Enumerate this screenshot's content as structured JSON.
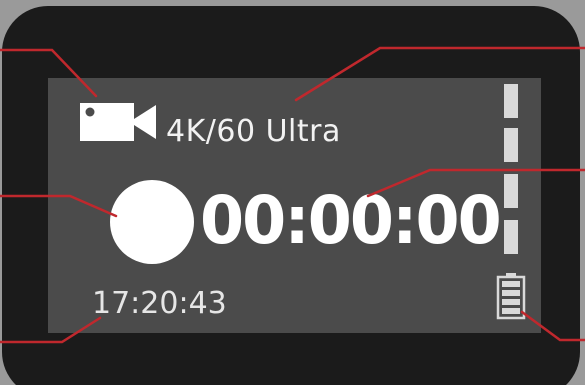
{
  "screen": {
    "mode_icon": "video-camera-icon",
    "mode_label": "4K/60 Ultra",
    "record_indicator_icon": "record-dot-icon",
    "timer": "00:00:00",
    "clock": "17:20:43",
    "signal_icon": "signal-strength-icon",
    "battery_icon": "battery-icon",
    "battery_level": 1.0
  },
  "colors": {
    "background": "#9a9a9a",
    "device_body": "#1b1b1b",
    "screen": "#4b4b4b",
    "foreground": "#ffffff",
    "callout_line": "#c0282d"
  }
}
